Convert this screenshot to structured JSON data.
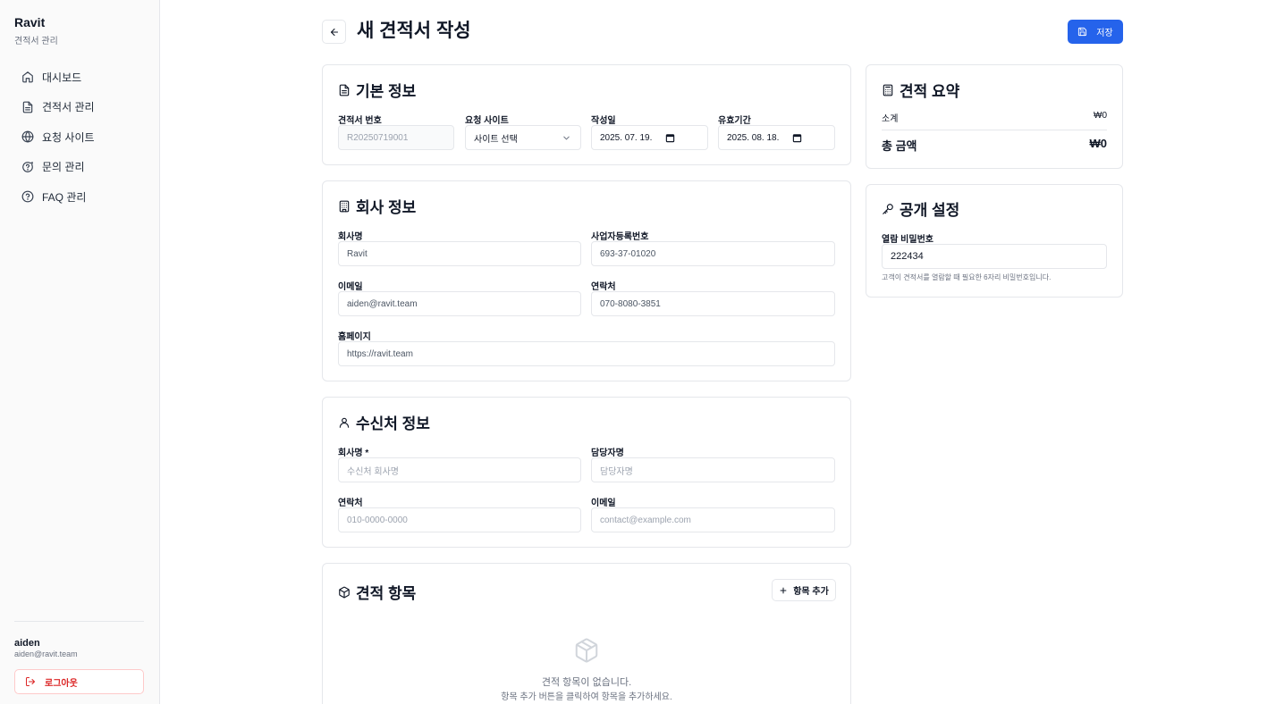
{
  "sidebar": {
    "brand": "Ravit",
    "brand_sub": "견적서 관리",
    "items": [
      {
        "label": "대시보드"
      },
      {
        "label": "견적서 관리"
      },
      {
        "label": "요청 사이트"
      },
      {
        "label": "문의 관리"
      },
      {
        "label": "FAQ 관리"
      }
    ],
    "user_name": "aiden",
    "user_email": "aiden@ravit.team",
    "logout": "로그아웃"
  },
  "header": {
    "title": "새 견적서 작성",
    "save_label": "저장"
  },
  "basic_info": {
    "title": "기본 정보",
    "quote_number_label": "견적서 번호",
    "quote_number_value": "R20250719001",
    "site_label": "요청 사이트",
    "site_value": "사이트 선택",
    "created_label": "작성일",
    "created_value": "2025. 07. 19.",
    "valid_label": "유효기간",
    "valid_value": "2025. 08. 18."
  },
  "company_info": {
    "title": "회사 정보",
    "name_label": "회사명",
    "name_value": "Ravit",
    "biz_label": "사업자등록번호",
    "biz_value": "693-37-01020",
    "email_label": "이메일",
    "email_value": "aiden@ravit.team",
    "phone_label": "연락처",
    "phone_value": "070-8080-3851",
    "homepage_label": "홈페이지",
    "homepage_value": "https://ravit.team"
  },
  "recipient_info": {
    "title": "수신처 정보",
    "company_label": "회사명 *",
    "company_placeholder": "수신처 회사명",
    "manager_label": "담당자명",
    "manager_placeholder": "담당자명",
    "phone_label": "연락처",
    "phone_placeholder": "010-0000-0000",
    "email_label": "이메일",
    "email_placeholder": "contact@example.com"
  },
  "items": {
    "title": "견적 항목",
    "add_label": "항목 추가",
    "empty_title": "견적 항목이 없습니다.",
    "empty_sub": "항목 추가 버튼을 클릭하여 항목을 추가하세요."
  },
  "summary": {
    "title": "견적 요약",
    "subtotal_label": "소계",
    "subtotal_value": "₩0",
    "total_label": "총 금액",
    "total_value": "₩0"
  },
  "public": {
    "title": "공개 설정",
    "password_label": "열람 비밀번호",
    "password_value": "222434",
    "help": "고객이 견적서를 열람할 때 필요한 6자리 비밀번호입니다."
  },
  "colors": {
    "primary": "#2563eb",
    "danger": "#dc2626"
  }
}
